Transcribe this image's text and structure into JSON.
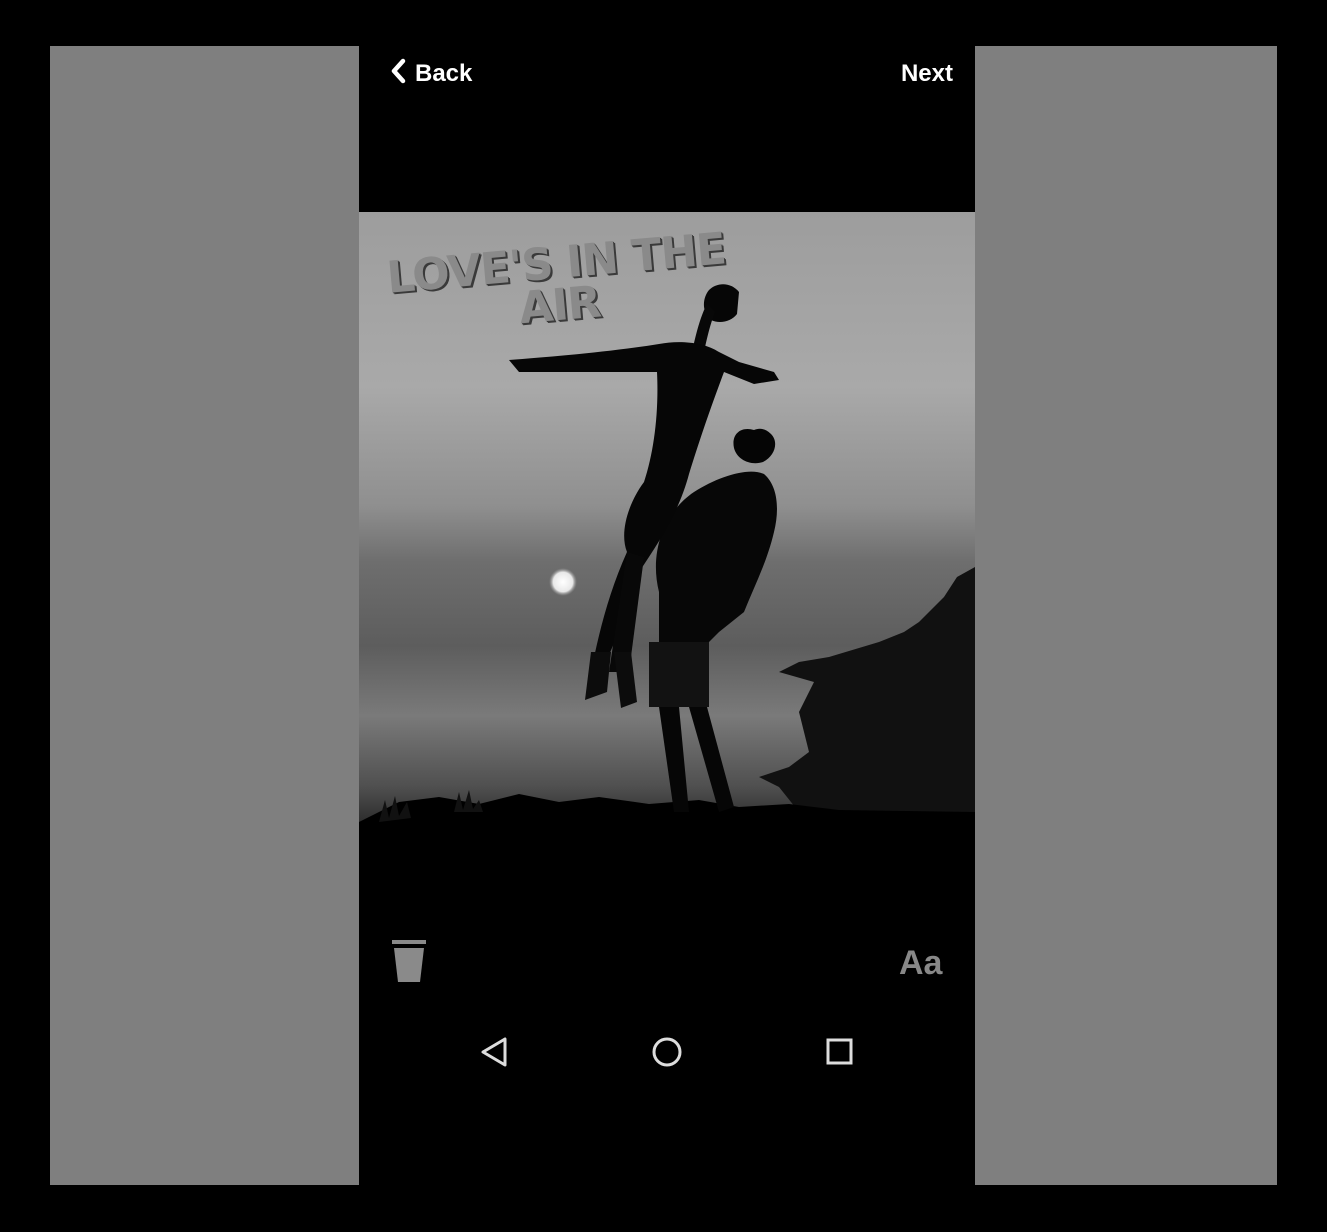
{
  "header": {
    "back_label": "Back",
    "next_label": "Next"
  },
  "editor": {
    "overlay_text_line1": "LOVE'S IN THE",
    "overlay_text_line2": "AIR",
    "text_style_label": "Aa"
  },
  "icons": {
    "back": "chevron-left-icon",
    "trash": "trash-icon",
    "nav_back": "triangle-back-icon",
    "nav_home": "circle-home-icon",
    "nav_recents": "square-recents-icon"
  },
  "colors": {
    "background": "#000000",
    "side_panels": "#7f7f7f",
    "overlay_text": "#8a8a8a"
  }
}
